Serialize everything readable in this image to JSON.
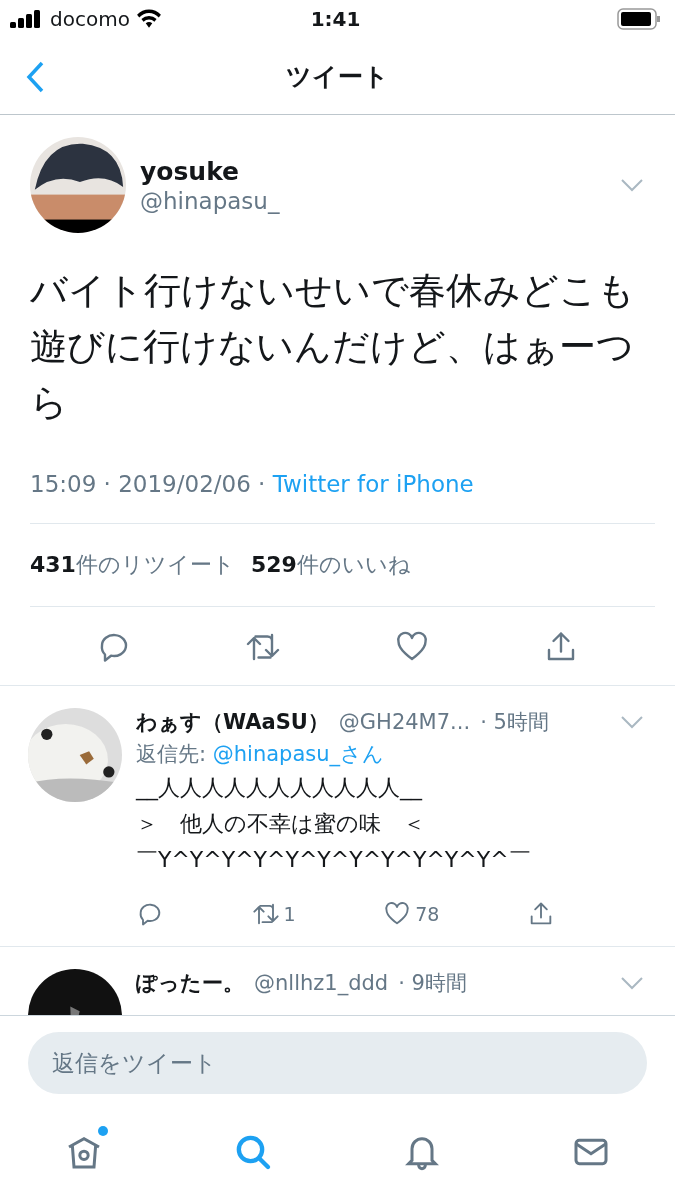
{
  "status_bar": {
    "carrier": "docomo",
    "time": "1:41"
  },
  "nav": {
    "title": "ツイート"
  },
  "tweet": {
    "name": "yosuke",
    "handle": "@hinapasu_",
    "text": "バイト行けないせいで春休みどこも遊びに行けないんだけど、はぁーつら",
    "time": "15:09 · 2019/02/06 · ",
    "source": "Twitter for iPhone",
    "retweets": "431",
    "retweets_label": "件のリツイート",
    "likes": "529",
    "likes_label": "件のいいね"
  },
  "replies": [
    {
      "name": "わぁす（WAaSU）",
      "handle": "@GH24M7...",
      "age": "· 5時間",
      "reply_to_label": "返信先: ",
      "reply_to": "@hinapasu_さん",
      "lines": [
        "__人人人人人人人人人人人__",
        "＞　他人の不幸は蜜の味　＜",
        "￣Y^Y^Y^Y^Y^Y^Y^Y^Y^Y^Y^￣"
      ],
      "retweets": "1",
      "likes": "78"
    },
    {
      "name": "ぽったー。",
      "handle": "@nllhz1_ddd",
      "age": "· 9時間"
    }
  ],
  "composer": {
    "placeholder": "返信をツイート"
  },
  "tab_bar": [
    {
      "kind": "home",
      "selected": false,
      "badge": true
    },
    {
      "kind": "search",
      "selected": true,
      "badge": false
    },
    {
      "kind": "notifications",
      "selected": false,
      "badge": false
    },
    {
      "kind": "messages",
      "selected": false,
      "badge": false
    }
  ]
}
